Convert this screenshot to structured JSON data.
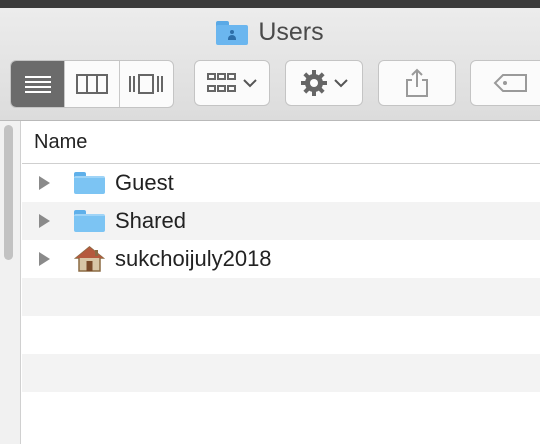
{
  "window": {
    "title": "Users"
  },
  "toolbar": {
    "view_modes": [
      "list",
      "columns",
      "cover-flow"
    ],
    "selected_view": "list"
  },
  "list": {
    "column_header": "Name",
    "items": [
      {
        "name": "Guest",
        "type": "folder"
      },
      {
        "name": "Shared",
        "type": "folder"
      },
      {
        "name": "sukchoijuly2018",
        "type": "home"
      }
    ]
  },
  "colors": {
    "selected_segment": "#6b6b6b",
    "folder_blue": "#7cc4f3",
    "alt_row": "#f3f3f3"
  }
}
